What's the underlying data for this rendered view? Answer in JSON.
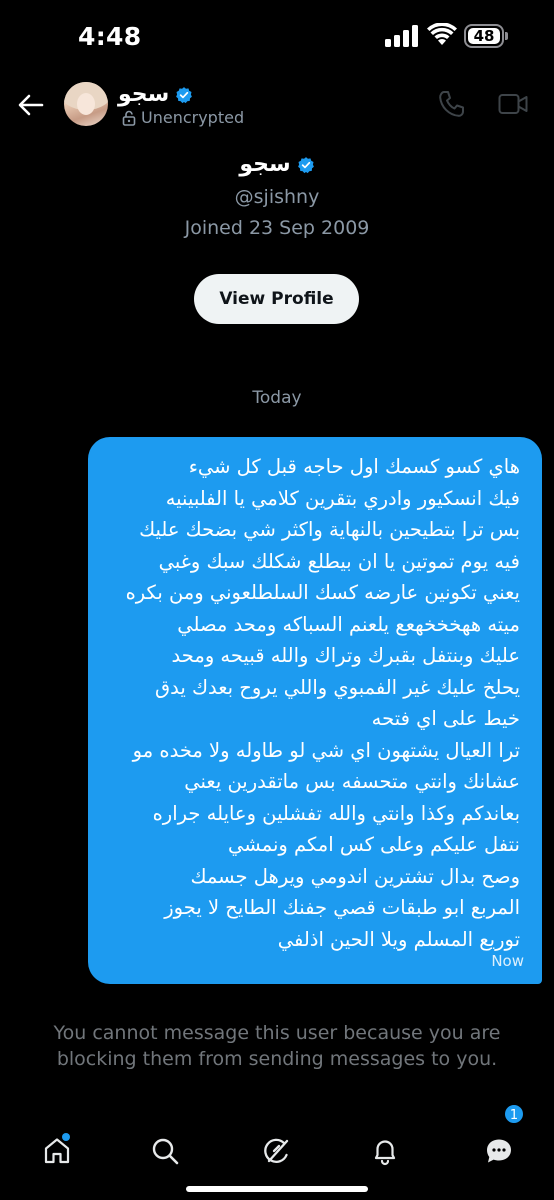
{
  "status_bar": {
    "time": "4:48",
    "battery": "48",
    "icons": [
      "cellular-signal-icon",
      "wifi-icon",
      "battery-icon"
    ]
  },
  "header": {
    "name": "سجو",
    "encryption_status": "Unencrypted",
    "icons": [
      "back-arrow-icon",
      "verified-badge-icon",
      "lock-icon",
      "phone-call-icon",
      "video-call-icon"
    ]
  },
  "profile": {
    "name": "سجو",
    "handle": "@sjishny",
    "joined": "Joined 23 Sep 2009",
    "view_profile_label": "View Profile"
  },
  "conversation": {
    "day_label": "Today",
    "messages": [
      {
        "direction": "outgoing",
        "text": "هاي كسو كسمك اول حاجه قبل كل شيء\nفيك انسكيور وادري بتقرين كلامي يا الفلبينيه\nبس ترا بتطيحين بالنهاية واكثر شي بضحك عليك\nفيه يوم تموتين يا ان بيطلع شكلك سبك وغبي\nيعني تكونين عارضه كسك السلطلعوني ومن بكره\nميته ههخخخهعع يلعنم السباكه ومحد مصلي\nعليك وبنتفل بقبرك وتراك والله قبيحه ومحد\nيحلخ عليك غير الفمبوي واللي يروح بعدك يدق\nخيط على اي فتحه\nترا العيال يشتهون اي شي لو طاوله ولا مخده مو\nعشانك وانتي متحسفه بس ماتقدرين يعني\nبعاندكم وكذا وانتي والله تفشلين وعايله جراره\nنتفل عليكم وعلى كس امكم ونمشي\nوصح بدال تشترين اندومي ويرهل جسمك\nالمربع ابو طبقات قصي جفنك الطايح لا يجوز\nتوريع المسلم ويلا الحين اذلفي",
        "time": "Now",
        "color": "#1d9bf0"
      }
    ],
    "blocked_notice": "You cannot message this user because you are blocking them from sending messages to you."
  },
  "tab_bar": {
    "tabs": [
      "home-icon",
      "search-icon",
      "grok-icon",
      "notifications-icon",
      "messages-icon"
    ],
    "messages_badge": "1"
  },
  "colors": {
    "background": "#000000",
    "accent": "#1d9bf0",
    "secondary_text": "#8b98a5"
  }
}
